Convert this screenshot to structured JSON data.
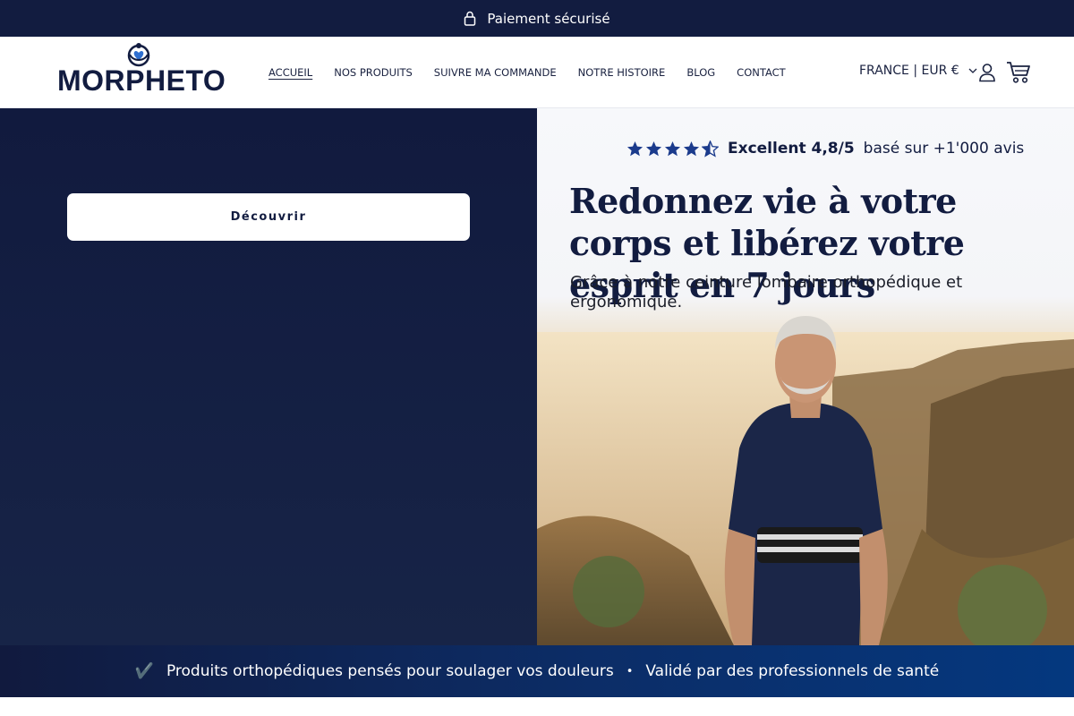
{
  "announcement": {
    "text": "Paiement sécurisé",
    "icon": "lock-icon"
  },
  "header": {
    "logo_text": "MORPHETO",
    "nav": [
      {
        "label": "ACCUEIL",
        "active": true
      },
      {
        "label": "NOS PRODUITS",
        "active": false
      },
      {
        "label": "SUIVRE MA COMMANDE",
        "active": false
      },
      {
        "label": "NOTRE HISTOIRE",
        "active": false
      },
      {
        "label": "BLOG",
        "active": false
      },
      {
        "label": "CONTACT",
        "active": false
      }
    ],
    "locale": "FRANCE | EUR €",
    "icons": [
      "account-icon",
      "cart-icon"
    ]
  },
  "hero": {
    "cta_label": "Découvrir",
    "rating": {
      "score_label": "Excellent 4,8/5",
      "suffix": "basé sur +1'000 avis",
      "stars": 4.5
    },
    "headline": "Redonnez vie à votre corps et libérez votre esprit en 7 jours",
    "subline": "Grâce à notre ceinture lombaire orthopédique et ergonomique."
  },
  "trust_bar": {
    "left": "Produits orthopédiques pensés pour soulager vos douleurs",
    "right": "Validé par des professionnels de santé",
    "check": "✔️",
    "separator": "•"
  },
  "colors": {
    "navy": "#121c40",
    "white": "#ffffff",
    "accent_blue": "#04387f"
  }
}
